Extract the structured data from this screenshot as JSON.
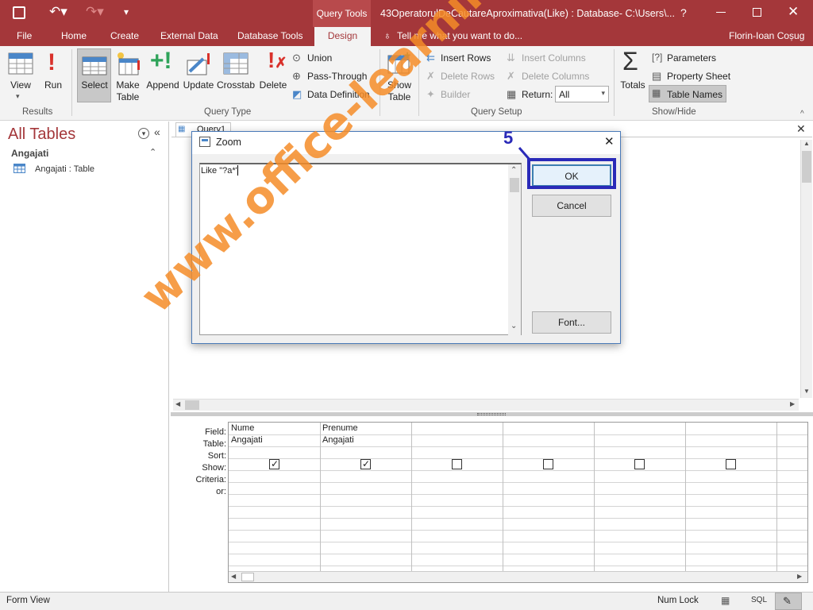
{
  "title_bar": {
    "context_tab": "Query Tools",
    "window_title": "43OperatorulDeCautareAproximativa(Like) : Database- C:\\Users\\...",
    "help": "?"
  },
  "tabs": [
    "File",
    "Home",
    "Create",
    "External Data",
    "Database Tools",
    "Design"
  ],
  "tell_me": "Tell me what you want to do...",
  "user": "Florin-Ioan Coșug",
  "ribbon": {
    "results": {
      "view": "View",
      "run": "Run",
      "label": "Results"
    },
    "query_type": {
      "select": "Select",
      "make": "Make",
      "table": "Table",
      "append": "Append",
      "update": "Update",
      "crosstab": "Crosstab",
      "delete": "Delete",
      "union": "Union",
      "pass_through": "Pass-Through",
      "data_definition": "Data Definition",
      "label": "Query Type"
    },
    "query_setup": {
      "show": "Show",
      "table": "Table",
      "insert_rows": "Insert Rows",
      "delete_rows": "Delete Rows",
      "builder": "Builder",
      "insert_columns": "Insert Columns",
      "delete_columns": "Delete Columns",
      "return_label": "Return:",
      "return_value": "All",
      "label": "Query Setup"
    },
    "show_hide": {
      "totals": "Totals",
      "parameters": "Parameters",
      "property_sheet": "Property Sheet",
      "table_names": "Table Names",
      "label": "Show/Hide"
    }
  },
  "nav_pane": {
    "header": "All Tables",
    "group": "Angajati",
    "item": "Angajati : Table"
  },
  "query_tab": "Query1",
  "dialog": {
    "title": "Zoom",
    "text": "Like \"?a*\"",
    "ok": "OK",
    "cancel": "Cancel",
    "font": "Font..."
  },
  "annotation_step": "5",
  "grid": {
    "row_labels": [
      "Field:",
      "Table:",
      "Sort:",
      "Show:",
      "Criteria:",
      "or:"
    ],
    "columns": [
      {
        "field": "Nume",
        "table": "Angajati",
        "show": true
      },
      {
        "field": "Prenume",
        "table": "Angajati",
        "show": true
      },
      {
        "field": "",
        "table": "",
        "show": false
      },
      {
        "field": "",
        "table": "",
        "show": false
      },
      {
        "field": "",
        "table": "",
        "show": false
      },
      {
        "field": "",
        "table": "",
        "show": false
      }
    ]
  },
  "status": {
    "left": "Form View",
    "num_lock": "Num Lock",
    "sql": "SQL"
  },
  "watermark": "www.office-learning.ro",
  "colors": {
    "accent": "#a4373a",
    "highlight": "#2a2ab8",
    "watermark": "#f58c28"
  }
}
